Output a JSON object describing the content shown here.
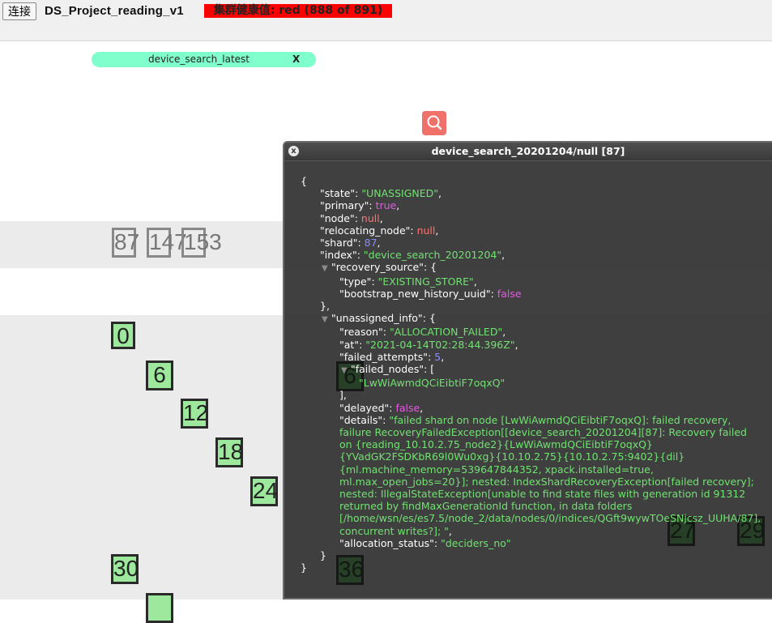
{
  "toolbar": {
    "connect_label": "连接",
    "cluster_name": "DS_Project_reading_v1",
    "health_text": "集群健康值: red (888 of 891)",
    "health_color": "#ff0000"
  },
  "filter": {
    "chip_label": "device_search_latest",
    "chip_close": "X",
    "chip_color": "#80ffcc"
  },
  "search_button": {
    "icon": "search-icon",
    "color": "#f0706a"
  },
  "shards": {
    "unassigned": [
      "87",
      "147",
      "153"
    ],
    "visible": [
      "0",
      "6",
      "12",
      "18",
      "24",
      "30",
      "6",
      "27",
      "29",
      "36"
    ]
  },
  "popup": {
    "title": "device_search_20201204/null [87]",
    "close": "x",
    "json": {
      "state_key": "\"state\"",
      "state_val": "\"UNASSIGNED\"",
      "primary_key": "\"primary\"",
      "primary_val": "true",
      "node_key": "\"node\"",
      "node_val": "null",
      "relocating_key": "\"relocating_node\"",
      "relocating_val": "null",
      "shard_key": "\"shard\"",
      "shard_val": "87",
      "index_key": "\"index\"",
      "index_val": "\"device_search_20201204\"",
      "recovery_key": "\"recovery_source\"",
      "type_key": "\"type\"",
      "type_val": "\"EXISTING_STORE\"",
      "bootstrap_key": "\"bootstrap_new_history_uuid\"",
      "bootstrap_val": "false",
      "unassigned_key": "\"unassigned_info\"",
      "reason_key": "\"reason\"",
      "reason_val": "\"ALLOCATION_FAILED\"",
      "at_key": "\"at\"",
      "at_val": "\"2021-04-14T02:28:44.396Z\"",
      "failed_attempts_key": "\"failed_attempts\"",
      "failed_attempts_val": "5",
      "failed_nodes_key": "\"failed_nodes\"",
      "failed_node_0": "\"LwWiAwmdQCiEibtiF7oqxQ\"",
      "delayed_key": "\"delayed\"",
      "delayed_val": "false",
      "details_key": "\"details\"",
      "details_val": "\"failed shard on node [LwWiAwmdQCiEibtiF7oqxQ]: failed recovery, failure RecoveryFailedException[[device_search_20201204][87]: Recovery failed on {reading_10.10.2.75_node2}{LwWiAwmdQCiEibtiF7oqxQ}{YVadGK2FSDKbR69l0Wu0xg}{10.10.2.75}{10.10.2.75:9402}{dil}{ml.machine_memory=539647844352, xpack.installed=true, ml.max_open_jobs=20}]; nested: IndexShardRecoveryException[failed recovery]; nested: IllegalStateException[unable to find state files with generation id 91312 returned by findMaxGenerationId function, in data folders [/home/wsn/es/es7.5/node_2/data/nodes/0/indices/QGft9wywTOeSNjcsz_UUHA/87], concurrent writes?]; \"",
      "allocation_key": "\"allocation_status\"",
      "allocation_val": "\"deciders_no\""
    }
  }
}
